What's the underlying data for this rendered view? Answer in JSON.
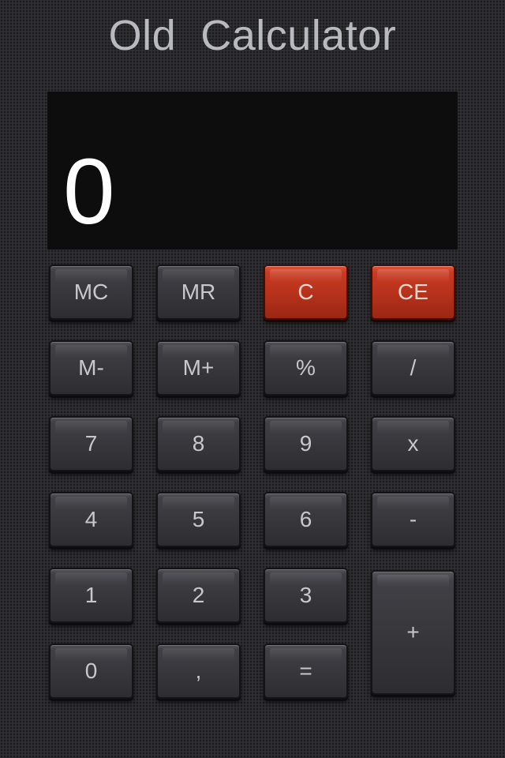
{
  "app": {
    "title": "Old  Calculator"
  },
  "display": {
    "value": "0"
  },
  "keys": {
    "mc": "MC",
    "mr": "MR",
    "c": "C",
    "ce": "CE",
    "m_minus": "M-",
    "m_plus": "M+",
    "percent": "%",
    "divide": "/",
    "seven": "7",
    "eight": "8",
    "nine": "9",
    "multiply": "x",
    "four": "4",
    "five": "5",
    "six": "6",
    "minus": "-",
    "one": "1",
    "two": "2",
    "three": "3",
    "plus": "+",
    "zero": "0",
    "decimal": ",",
    "equals": "="
  },
  "colors": {
    "background": "#2a2a2e",
    "key": "#3a3a3f",
    "key_text": "#c7c8cc",
    "clear_key": "#c23620",
    "display_bg": "#0d0d0d",
    "display_text": "#ffffff",
    "title_text": "#b8bac0"
  }
}
